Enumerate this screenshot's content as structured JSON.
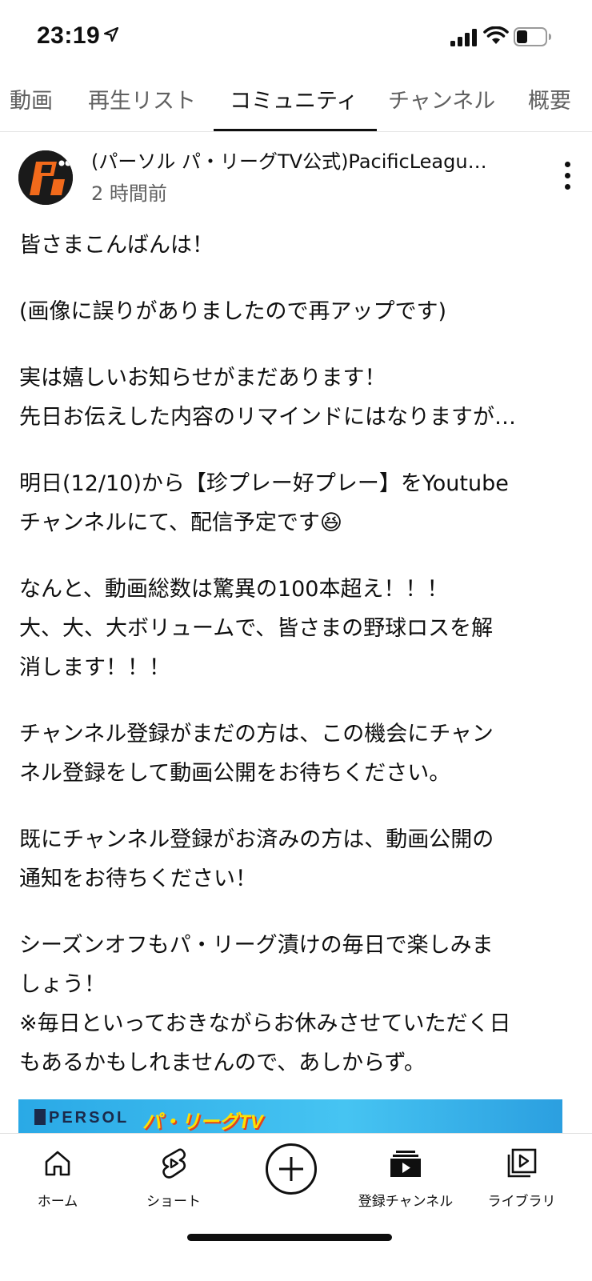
{
  "status_bar": {
    "time": "23:19"
  },
  "tabs": [
    {
      "label": "動画",
      "active": false
    },
    {
      "label": "再生リスト",
      "active": false
    },
    {
      "label": "コミュニティ",
      "active": true
    },
    {
      "label": "チャンネル",
      "active": false
    },
    {
      "label": "概要",
      "active": false
    }
  ],
  "post": {
    "avatar_text": "パ",
    "channel_name": "(パーソル パ・リーグTV公式)PacificLeagu…",
    "time_ago": "2 時間前",
    "paragraphs": [
      "皆さまこんばんは！",
      "(画像に誤りがありましたので再アップです)",
      "実は嬉しいお知らせがまだあります！\n先日お伝えした内容のリマインドにはなりますが…",
      "明日(12/10)から【珍プレー好プレー】をYoutube\nチャンネルにて、配信予定です😆",
      "なんと、動画総数は驚異の100本超え！！！\n大、大、大ボリュームで、皆さまの野球ロスを解\n消します！！！",
      "チャンネル登録がまだの方は、この機会にチャン\nネル登録をして動画公開をお待ちください。",
      "既にチャンネル登録がお済みの方は、動画公開の\n通知をお待ちください！",
      "シーズンオフもパ・リーグ漬けの毎日で楽しみま\nしょう！\n※毎日といっておきながらお休みさせていただく日\nもあるかもしれませんので、あしからず。"
    ],
    "image": {
      "brand_text": "PERSOL",
      "logo_text": "パ・リーグTV"
    }
  },
  "bottom_nav": {
    "home": "ホーム",
    "shorts": "ショート",
    "subscriptions": "登録チャンネル",
    "library": "ライブラリ"
  },
  "colors": {
    "text_primary": "#0f0f0f",
    "text_secondary": "#606060",
    "avatar_bg": "#1a1a1a",
    "avatar_accent": "#f26a1b",
    "banner_blue": "#2aa9e6"
  }
}
